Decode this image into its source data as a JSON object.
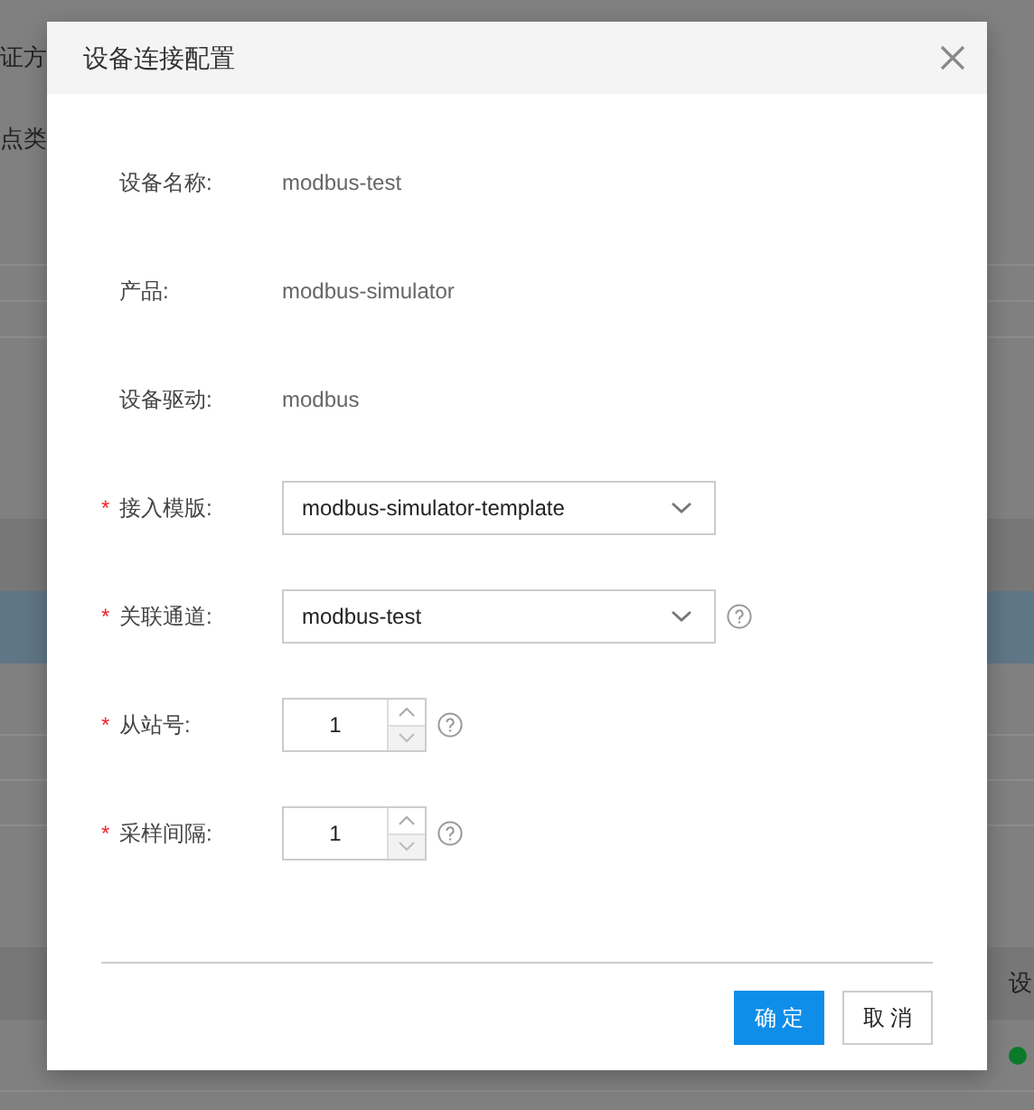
{
  "background": {
    "left_labels": [
      "证方",
      "点类"
    ],
    "right_label": "设"
  },
  "dialog": {
    "title": "设备连接配置",
    "fields": [
      {
        "kind": "text",
        "label": "设备名称:",
        "value": "modbus-test",
        "help": false
      },
      {
        "kind": "text",
        "label": "产品:",
        "value": "modbus-simulator",
        "help": false
      },
      {
        "kind": "text",
        "label": "设备驱动:",
        "value": "modbus",
        "help": false
      },
      {
        "kind": "select",
        "required_mark": "*",
        "label": "接入模版:",
        "value": "modbus-simulator-template",
        "help": false
      },
      {
        "kind": "select",
        "required_mark": "*",
        "label": "关联通道:",
        "value": "modbus-test",
        "help": true
      },
      {
        "kind": "number",
        "required_mark": "*",
        "label": "从站号:",
        "value": "1",
        "help": true
      },
      {
        "kind": "number",
        "required_mark": "*",
        "label": "采样间隔:",
        "value": "1",
        "help": true
      }
    ],
    "buttons": [
      {
        "label": "确 定",
        "primary": true
      },
      {
        "label": "取 消",
        "primary": false
      }
    ]
  }
}
